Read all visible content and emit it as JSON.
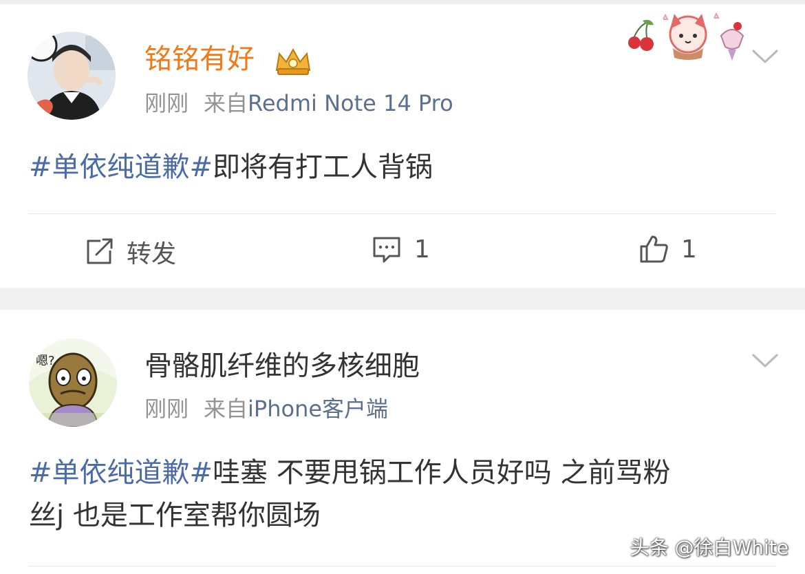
{
  "posts": [
    {
      "nickname": "铭铭有好",
      "time": "刚刚",
      "from_label": "来自",
      "source": "Redmi Note 14 Pro",
      "topic": "#单依纯道歉#",
      "text": "即将有打工人背锅",
      "text_line2": "",
      "actions": {
        "repost_label": "转发",
        "comment_count": "1",
        "like_count": "1"
      }
    },
    {
      "nickname": "骨骼肌纤维的多核细胞",
      "time": "刚刚",
      "from_label": "来自",
      "source": "iPhone客户端",
      "topic": "#单依纯道歉#",
      "text": "哇塞 不要甩锅工作人员好吗 之前骂粉",
      "text_line2": "丝j 也是工作室帮你圆场"
    }
  ],
  "avatar2_text": "嗯?",
  "watermark": "头条 @徐白White",
  "icons": {
    "more": "chevron-down-icon",
    "repost": "repost-icon",
    "comment": "comment-icon",
    "like": "thumbs-up-icon",
    "vip": "crown-badge-icon"
  },
  "colors": {
    "vip_name": "#f07a1a",
    "topic": "#4a6ba8",
    "source": "#5b6f8f",
    "meta": "#939393",
    "separator": "#f0f0f0"
  }
}
